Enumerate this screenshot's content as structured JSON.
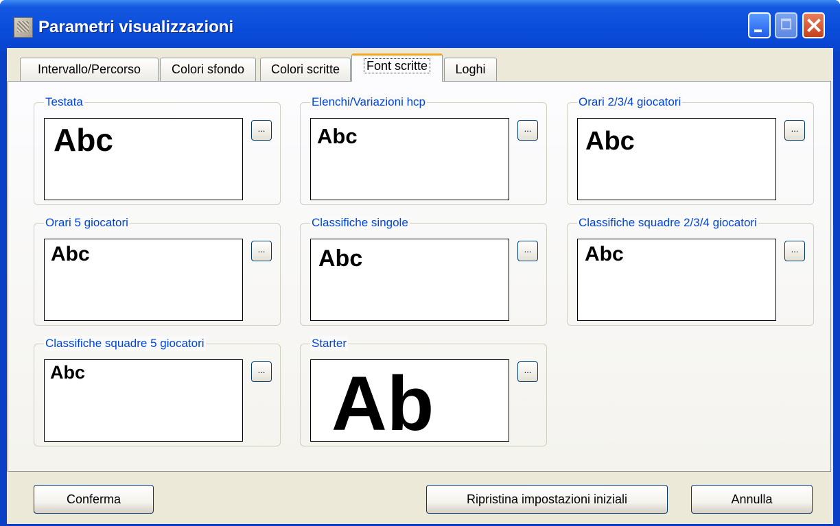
{
  "window": {
    "title": "Parametri visualizzazioni"
  },
  "tabs": [
    {
      "label": "Intervallo/Percorso"
    },
    {
      "label": "Colori sfondo"
    },
    {
      "label": "Colori scritte"
    },
    {
      "label": "Font scritte",
      "active": true
    },
    {
      "label": "Loghi"
    }
  ],
  "groups": [
    {
      "label": "Testata",
      "sample": "Abc"
    },
    {
      "label": "Elenchi/Variazioni  hcp",
      "sample": "Abc"
    },
    {
      "label": "Orari 2/3/4 giocatori",
      "sample": "Abc"
    },
    {
      "label": "Orari 5 giocatori",
      "sample": "Abc"
    },
    {
      "label": "Classifiche singole",
      "sample": "Abc"
    },
    {
      "label": "Classifiche squadre 2/3/4 giocatori",
      "sample": "Abc"
    },
    {
      "label": "Classifiche squadre 5 giocatori",
      "sample": "Abc"
    },
    {
      "label": "Starter",
      "sample": "Ab"
    }
  ],
  "font_button_label": "...",
  "buttons": {
    "confirm": "Conferma",
    "reset": "Ripristina impostazioni iniziali",
    "cancel": "Annulla"
  }
}
